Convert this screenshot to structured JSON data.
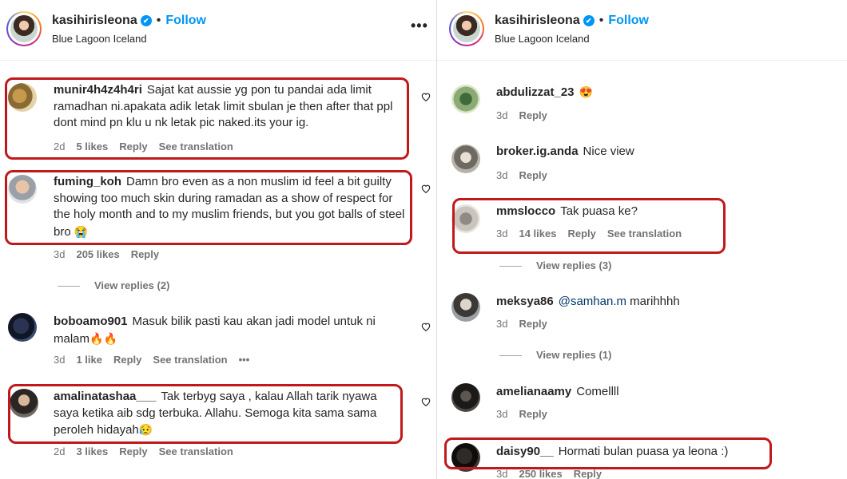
{
  "left": {
    "header": {
      "username": "kasihirisleona",
      "dot": "•",
      "follow": "Follow",
      "location": "Blue Lagoon Iceland",
      "more": "•••"
    },
    "comments": [
      {
        "user": "munir4h4z4h4ri",
        "text": "Sajat kat aussie yg pon tu pandai ada limit ramadhan ni.apakata adik letak limit sbulan je then after that ppl dont mind pn klu u nk letak pic naked.its your ig.",
        "time": "2d",
        "likes": "5 likes",
        "reply": "Reply",
        "translate": "See translation"
      },
      {
        "user": "fuming_koh",
        "text": "Damn bro even as a non muslim id feel a bit guilty showing too much skin during ramadan as a show of respect for the holy month and to my muslim friends, but you got balls of steel bro",
        "emoji": "😭",
        "time": "3d",
        "likes": "205 likes",
        "reply": "Reply"
      },
      {
        "user": "boboamo901",
        "text": "Masuk bilik pasti kau akan jadi model untuk ni malam",
        "emoji": "🔥🔥",
        "time": "3d",
        "likes": "1 like",
        "reply": "Reply",
        "translate": "See translation",
        "more": "•••"
      },
      {
        "user": "amalinatashaa___",
        "text": "Tak terbyg saya , kalau Allah tarik nyawa saya ketika aib sdg terbuka. Allahu. Semoga kita sama sama peroleh hidayah",
        "emoji": "😥",
        "time": "2d",
        "likes": "3 likes",
        "reply": "Reply",
        "translate": "See translation"
      }
    ],
    "view_replies": "View replies (2)"
  },
  "right": {
    "header": {
      "username": "kasihirisleona",
      "dot": "•",
      "follow": "Follow",
      "location": "Blue Lagoon Iceland"
    },
    "comments": [
      {
        "user": "abdulizzat_23",
        "emoji": "😍",
        "time": "3d",
        "reply": "Reply"
      },
      {
        "user": "broker.ig.anda",
        "text": "Nice view",
        "time": "3d",
        "reply": "Reply"
      },
      {
        "user": "mmslocco",
        "text": "Tak puasa ke?",
        "time": "3d",
        "likes": "14 likes",
        "reply": "Reply",
        "translate": "See translation"
      },
      {
        "user": "meksya86",
        "mention": "@samhan.m",
        "text": "marihhhh",
        "time": "3d",
        "reply": "Reply"
      },
      {
        "user": "amelianaamy",
        "text": "Comellll",
        "time": "3d",
        "reply": "Reply"
      },
      {
        "user": "daisy90__",
        "text": "Hormati bulan puasa ya leona :)",
        "time": "3d",
        "likes": "250 likes",
        "reply": "Reply"
      }
    ],
    "view_replies_1": "View replies (3)",
    "view_replies_2": "View replies (1)"
  },
  "colors": {
    "accent": "#0095f6",
    "highlight_box": "#c0191c",
    "secondary_text": "#737373"
  }
}
